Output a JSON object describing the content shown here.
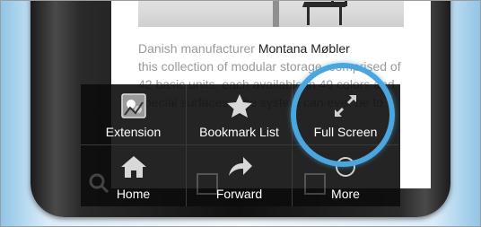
{
  "article": {
    "lead": "Danish manufacturer",
    "brand": "Montana Møbler",
    "continued": "this collection of modular storage, comprised of 42 basic units, each available in 49 colors and special surfaces. The system can ever be to"
  },
  "menu": {
    "items": [
      {
        "label": "Extension",
        "icon": "extension-icon"
      },
      {
        "label": "Bookmark List",
        "icon": "star-icon"
      },
      {
        "label": "Full Screen",
        "icon": "fullscreen-icon"
      },
      {
        "label": "Home",
        "icon": "home-icon"
      },
      {
        "label": "Forward",
        "icon": "forward-arrow-icon"
      },
      {
        "label": "More",
        "icon": "more-icon"
      }
    ]
  },
  "colors": {
    "highlight": "#4aa6dd",
    "menu_bg": "#0c0c0c",
    "icon_gray": "#cfcfcf"
  }
}
